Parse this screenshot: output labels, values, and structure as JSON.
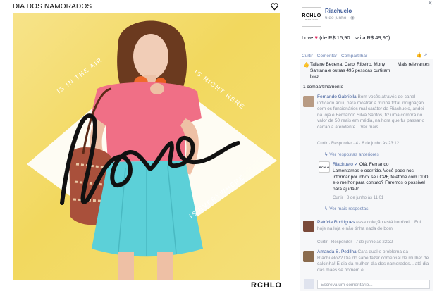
{
  "photo": {
    "title": "DIA DOS NAMORADOS",
    "diag_left": "IS IN THE AIR",
    "diag_right": "IS RIGHT HERE",
    "diag_bottom": "IS EVERYWHERE",
    "script_word": "love",
    "brand": "RCHLO"
  },
  "post": {
    "avatar_logo": "RCHLO",
    "avatar_sub": "RIACHUELO",
    "page_name": "Riachuelo",
    "date": "6 de junho · ",
    "text_before": "Love ",
    "text_after": " (de R$ 15,90 | sai a R$ 49,90)",
    "actions": [
      "Curtir",
      "Comentar",
      "Compartilhar"
    ],
    "colors": {
      "link": "#3b5998",
      "heart": "#e0245e",
      "panel": "#f6f7f9"
    }
  },
  "likes": {
    "text": "Taliane Becerra, Carol Ribeiro, Mony Santana e outras 495 pessoas curtiram isso.",
    "more": "Mais relevantes"
  },
  "shares": "1 compartilhamento",
  "comments": [
    {
      "author": "Fernando Gabriella",
      "text": "Bom vocês através do canal indicado aqui, para mostrar a minha total indignação com os funcionários mal caráter da Riachuelo, andei na loja e Fernando Silva Santos, fiz uma compra no valor de 50 reais em média, na hora que fui passar o cartão a atendente... Ver mais",
      "meta": "Curtir · Responder · 4 · 6 de junho às 23:12"
    },
    {
      "author": "Patrícia Rodrigues",
      "text": "essa coleção está horrível... Fui hoje na loja e não tinha nada de bom",
      "meta": "Curtir · Responder · 7 de junho às 22:32"
    },
    {
      "author": "Amanda S. Pedilha",
      "text": "Cara qual o problema da Riachuelo?? Dia do sabe fazer comercial de mulher de calcinha! E dia da mulher, dia dos namorados... até dia das mães se homem e ...",
      "meta": ""
    }
  ],
  "replies_link_1": "Ver respostas anteriores",
  "reply": {
    "author": "Riachuelo",
    "verified": "✓",
    "greeting": "Olá, Fernando",
    "text": "Lamentamos o ocorrido. Você pode nos informar por inbox seu CPF, telefone com DDD e o melhor para contato? Faremos o possível para ajudá-lo.",
    "meta": "Curtir · 8 de junho às 11:01"
  },
  "replies_link_2": "Ver mais respostas",
  "composer": {
    "placeholder": "Escreva um comentário..."
  }
}
